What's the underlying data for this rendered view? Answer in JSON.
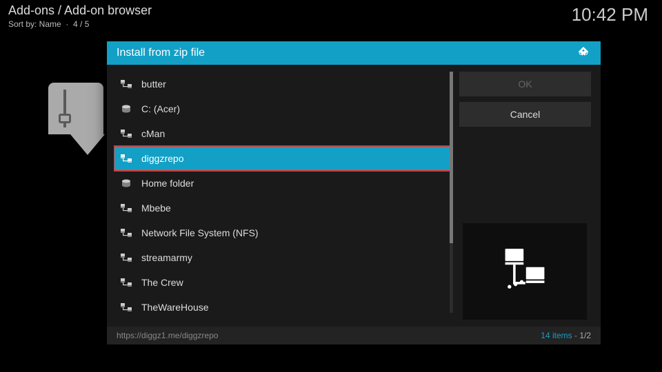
{
  "header": {
    "breadcrumb": "Add-ons / Add-on browser",
    "sort_prefix": "Sort by: Name",
    "sort_page": "4 / 5",
    "clock": "10:42 PM"
  },
  "dialog": {
    "title": "Install from zip file",
    "items": [
      {
        "label": "butter",
        "icon": "net",
        "selected": false
      },
      {
        "label": "C: (Acer)",
        "icon": "disk",
        "selected": false
      },
      {
        "label": "cMan",
        "icon": "net",
        "selected": false
      },
      {
        "label": "diggzrepo",
        "icon": "net",
        "selected": true,
        "highlight_box": true
      },
      {
        "label": "Home folder",
        "icon": "disk",
        "selected": false
      },
      {
        "label": "Mbebe",
        "icon": "net",
        "selected": false
      },
      {
        "label": "Network File System (NFS)",
        "icon": "net",
        "selected": false
      },
      {
        "label": "streamarmy",
        "icon": "net",
        "selected": false
      },
      {
        "label": "The Crew",
        "icon": "net",
        "selected": false
      },
      {
        "label": "TheWareHouse",
        "icon": "net",
        "selected": false
      }
    ],
    "buttons": {
      "ok": "OK",
      "cancel": "Cancel"
    },
    "footer": {
      "path": "https://diggz1.me/diggzrepo",
      "count": "14 items",
      "page": "1/2"
    },
    "scroll": {
      "thumb_height_pct": 71
    }
  }
}
